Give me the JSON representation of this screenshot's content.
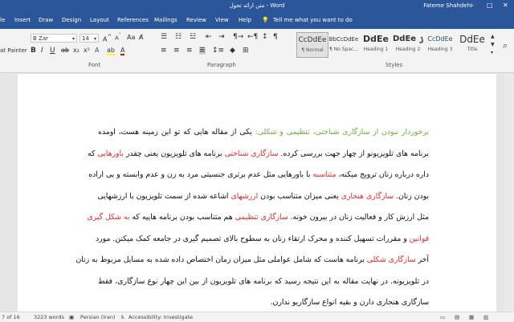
{
  "titlebar": {
    "doc_title": "متن ارائه تحول",
    "app": "Word",
    "user": "Fateme Shahdehi",
    "min": "–",
    "max": "□",
    "close": "✕"
  },
  "tabs": [
    "le",
    "Insert",
    "Draw",
    "Design",
    "Layout",
    "References",
    "Mailings",
    "Review",
    "View",
    "Help"
  ],
  "tell_me": "Tell me what you want to do",
  "ribbon": {
    "format_painter": "at Painter",
    "font_name": "B Zar",
    "font_size": "14",
    "groups": {
      "font": "Font",
      "paragraph": "Paragraph",
      "styles": "Styles"
    },
    "styles": [
      {
        "preview": "‎CcDdEe",
        "name": "¶ Normal"
      },
      {
        "preview": "BbCcDdEe",
        "name": "¶ No Spac..."
      },
      {
        "preview": "DdEe",
        "name": "Heading 1"
      },
      {
        "preview": "DdEe ۯ",
        "name": "Heading 2"
      },
      {
        "preview": "‎CcDdEe",
        "name": "Heading 3"
      },
      {
        "preview": "DdEe",
        "name": "Title"
      }
    ]
  },
  "document": {
    "lines": [
      [
        {
          "t": "برخوردار نبودن از سازگاری شناختی، تنظیمی و شکلی:",
          "c": "g"
        },
        {
          "t": " یکی از مقاله هایی که تو این زمینه هست، اومده"
        }
      ],
      [
        {
          "t": "برنامه های تلویزیونو از چهار جهت بررسی کرده. "
        },
        {
          "t": "سازگاری شناختی",
          "c": "r"
        },
        {
          "t": " برنامه های تلویزیون یعنی چقدر "
        },
        {
          "t": "باورهایی",
          "c": "r"
        },
        {
          "t": " که"
        }
      ],
      [
        {
          "t": "داره درباره زنان ترویج میکنه، "
        },
        {
          "t": "متناسبه",
          "c": "r"
        },
        {
          "t": " با باورهایی مثل عدم برتری جنسیتی مرد به زن و عدم وابسته و بی اراده"
        }
      ],
      [
        {
          "t": "بودن زنان. "
        },
        {
          "t": "سازگاری هنجاری",
          "c": "r"
        },
        {
          "t": " یعنی میزان متناسب بودن "
        },
        {
          "t": "ارزشهای",
          "c": "r"
        },
        {
          "t": " اشاعه شده از سمت تلویزیون با ارزشهایی"
        }
      ],
      [
        {
          "t": "مثل ارزش کار و فعالیت زنان در بیرون خونه. "
        },
        {
          "t": "سازگاری تنظیمی",
          "c": "r"
        },
        {
          "t": " هم متناسب بودن برنامه هاییه که "
        },
        {
          "t": "به شکل گیری",
          "c": "r"
        }
      ],
      [
        {
          "t": "قوانین",
          "c": "r"
        },
        {
          "t": " و مقررات تسهیل کننده و محرک ارتقاء زنان به سطوح بالای تصمیم گیری در جامعه کمک میکنن. مورد"
        }
      ],
      [
        {
          "t": "آخر "
        },
        {
          "t": "سازگاری شکلی",
          "c": "r"
        },
        {
          "t": " برنامه هاست که شامل عواملی مثل میزان زمان اختصاص داده شده به مسایل مربوط به زنان"
        }
      ],
      [
        {
          "t": "در تلویزیونه. در نهایت مقاله به این نتیجه رسید که برنامه های تلویزیون از بین این چهار نوع سازگاری، فقط"
        }
      ],
      [
        {
          "t": "سازگاری هنجاری دارن و بقیه انواع سازگاریو ندارن."
        }
      ]
    ]
  },
  "status": {
    "page": "7 of 16",
    "words": "3223 words",
    "language": "Persian (Iran)",
    "accessibility": "Accessibility: Investigate"
  }
}
